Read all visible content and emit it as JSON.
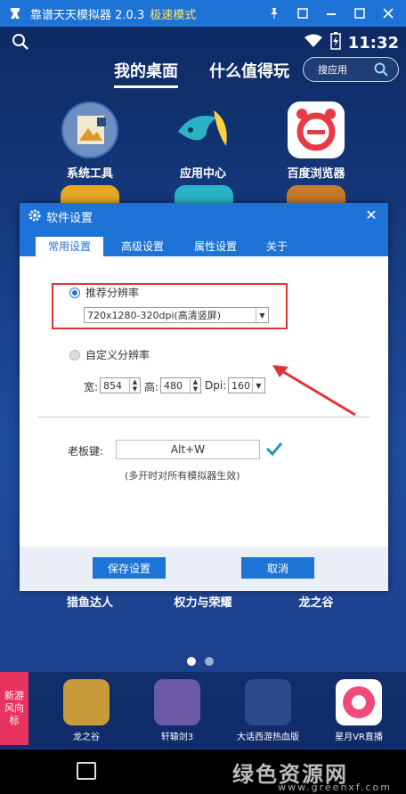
{
  "window": {
    "title": "靠谱天天模拟器 2.0.3",
    "mode": "极速模式",
    "controls": [
      "pin",
      "restore",
      "minimize",
      "maximize",
      "close"
    ]
  },
  "status": {
    "time": "11:32"
  },
  "desktop": {
    "tabs": [
      "我的桌面",
      "什么值得玩"
    ],
    "search_placeholder": "搜应用",
    "apps_row1": [
      "系统工具",
      "应用中心",
      "百度浏览器"
    ],
    "apps_row3": [
      "猎鱼达人",
      "权力与荣耀",
      "龙之谷"
    ],
    "dock_label": "新游风向标",
    "dock_apps": [
      "龙之谷",
      "轩辕剑3",
      "大话西游热血版",
      "星月VR直播"
    ]
  },
  "navbar": {
    "watermark": "绿色资源网",
    "watermark_url": "www.greenxf.com"
  },
  "dialog": {
    "title": "软件设置",
    "tabs": [
      "常用设置",
      "高级设置",
      "属性设置",
      "关于"
    ],
    "recommended_label": "推荐分辨率",
    "recommended_value": "720x1280-320dpi(高清竖屏)",
    "custom_label": "自定义分辨率",
    "width_label": "宽:",
    "width_value": "854",
    "height_label": "高:",
    "height_value": "480",
    "dpi_label": "Dpi:",
    "dpi_value": "160",
    "boss_key_label": "老板键:",
    "boss_key_value": "Alt+W",
    "boss_key_note": "(多开时对所有模拟器生效)",
    "save_label": "保存设置",
    "cancel_label": "取消"
  },
  "colors": {
    "accent": "#1e73d6",
    "highlight": "#e03434",
    "mode": "#ffe86b"
  }
}
